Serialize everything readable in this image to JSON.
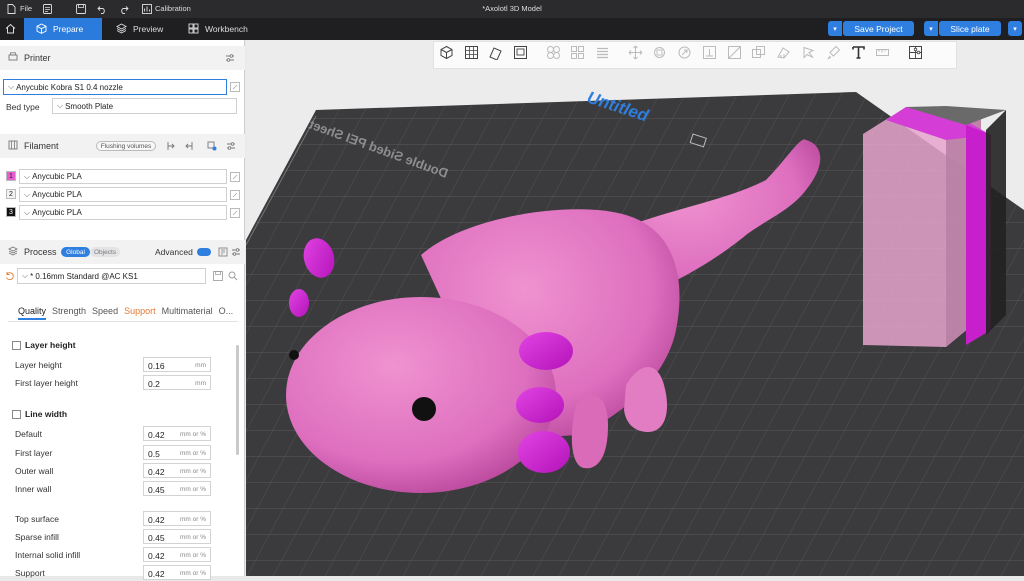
{
  "titlebar": {
    "file_label": "File",
    "calibration_label": "Calibration",
    "window_title": "*Axolotl 3D Model"
  },
  "tabs": [
    {
      "label": "Prepare"
    },
    {
      "label": "Preview"
    },
    {
      "label": "Workbench"
    }
  ],
  "actions": {
    "save_project": "Save Project",
    "slice_plate": "Slice plate"
  },
  "printer": {
    "section_title": "Printer",
    "printer_name": "Anycubic Kobra S1 0.4 nozzle",
    "bed_type_label": "Bed type",
    "bed_type_value": "Smooth Plate"
  },
  "filament": {
    "section_title": "Filament",
    "flushing_button": "Flushing volumes",
    "items": [
      {
        "index": "1",
        "name": "Anycubic PLA",
        "color": "#e75fcf"
      },
      {
        "index": "2",
        "name": "Anycubic PLA",
        "color": "#f2f2f2"
      },
      {
        "index": "3",
        "name": "Anycubic PLA",
        "color": "#111111"
      }
    ]
  },
  "process": {
    "section_title": "Process",
    "global_label": "Global",
    "objects_label": "Objects",
    "advanced_label": "Advanced",
    "profile": "* 0.16mm Standard @AC KS1",
    "subtabs": [
      "Quality",
      "Strength",
      "Speed",
      "Support",
      "Multimaterial",
      "O..."
    ],
    "groups": [
      {
        "title": "Layer height",
        "rows": [
          {
            "label": "Layer height",
            "value": "0.16",
            "unit": "mm"
          },
          {
            "label": "First layer height",
            "value": "0.2",
            "unit": "mm"
          }
        ]
      },
      {
        "title": "Line width",
        "rows": [
          {
            "label": "Default",
            "value": "0.42",
            "unit": "mm or %"
          },
          {
            "label": "First layer",
            "value": "0.5",
            "unit": "mm or %"
          },
          {
            "label": "Outer wall",
            "value": "0.42",
            "unit": "mm or %"
          },
          {
            "label": "Inner wall",
            "value": "0.45",
            "unit": "mm or %"
          },
          {
            "label": "Top surface",
            "value": "0.42",
            "unit": "mm or %"
          },
          {
            "label": "Sparse infill",
            "value": "0.45",
            "unit": "mm or %"
          },
          {
            "label": "Internal solid infill",
            "value": "0.42",
            "unit": "mm or %"
          },
          {
            "label": "Support",
            "value": "0.42",
            "unit": "mm or %"
          }
        ]
      }
    ]
  },
  "viewport": {
    "plate_name": "Untitled",
    "plate_text": "Double Sided PEI Sheet",
    "model_color": "#e37ac4",
    "accent_color": "#d42ad6",
    "bed_color": "#3b3b3d"
  },
  "colors": {
    "accent": "#2f7fe0",
    "warning": "#e07a2f"
  }
}
